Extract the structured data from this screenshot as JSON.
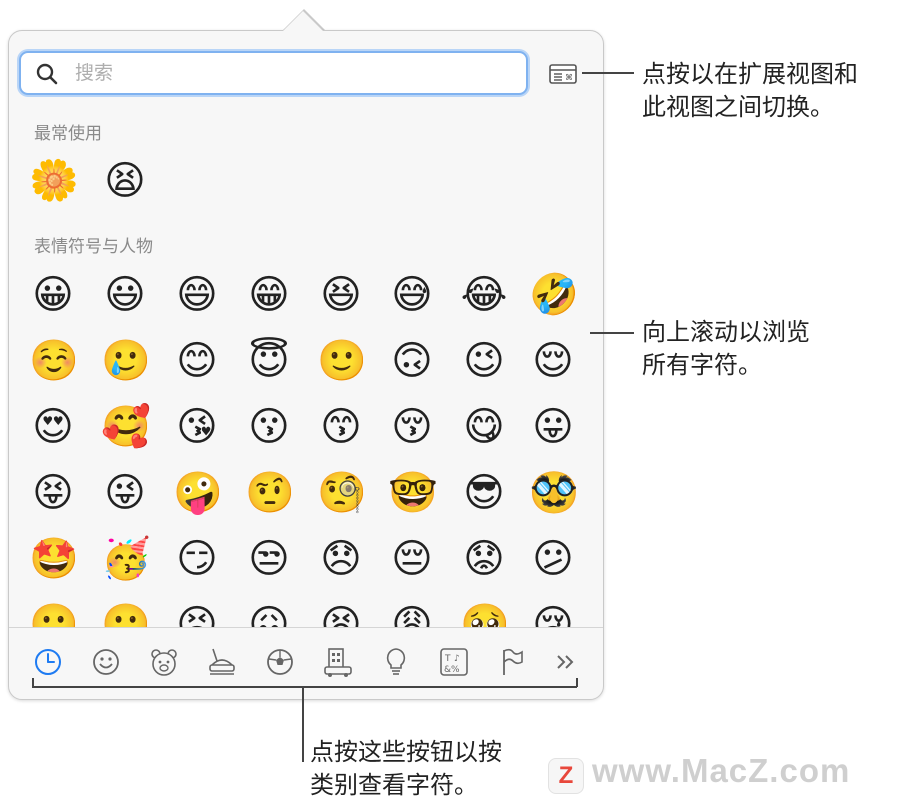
{
  "search": {
    "placeholder": "搜索",
    "value": ""
  },
  "sections": {
    "recent_title": "最常使用",
    "people_title": "表情符号与人物"
  },
  "recent_emojis": [
    "🌼",
    "😫"
  ],
  "emoji_rows": [
    [
      "😀",
      "😃",
      "😄",
      "😁",
      "😆",
      "😅",
      "😂",
      "🤣"
    ],
    [
      "☺️",
      "🥲",
      "😊",
      "😇",
      "🙂",
      "🙃",
      "😉",
      "😌"
    ],
    [
      "😍",
      "🥰",
      "😘",
      "😗",
      "😙",
      "😚",
      "😋",
      "😛"
    ],
    [
      "😝",
      "😜",
      "🤪",
      "🤨",
      "🧐",
      "🤓",
      "😎",
      "🥸"
    ],
    [
      "🤩",
      "🥳",
      "😏",
      "😒",
      "😞",
      "😔",
      "😟",
      "😕"
    ],
    [
      "🙁",
      "☹️",
      "😣",
      "😖",
      "😫",
      "😩",
      "🥺",
      "😢"
    ]
  ],
  "categories": [
    {
      "name": "recent",
      "icon": "clock-icon",
      "active": true
    },
    {
      "name": "smileys",
      "icon": "smiley-icon"
    },
    {
      "name": "animals",
      "icon": "bear-icon"
    },
    {
      "name": "food",
      "icon": "food-icon"
    },
    {
      "name": "activity",
      "icon": "ball-icon"
    },
    {
      "name": "travel",
      "icon": "building-icon"
    },
    {
      "name": "objects",
      "icon": "lightbulb-icon"
    },
    {
      "name": "symbols",
      "icon": "symbols-icon"
    },
    {
      "name": "flags",
      "icon": "flag-icon"
    },
    {
      "name": "more",
      "icon": "double-chevron-icon"
    }
  ],
  "colors": {
    "accent": "#1e7bf2",
    "search_border": "#7fb2f0"
  },
  "annotations": {
    "toggle": "点按以在扩展视图和\n此视图之间切换。",
    "scroll": "向上滚动以浏览\n所有字符。",
    "categories": "点按这些按钮以按\n类别查看字符。"
  },
  "watermark": "www.MacZ.com",
  "watermark_logo": "Z"
}
